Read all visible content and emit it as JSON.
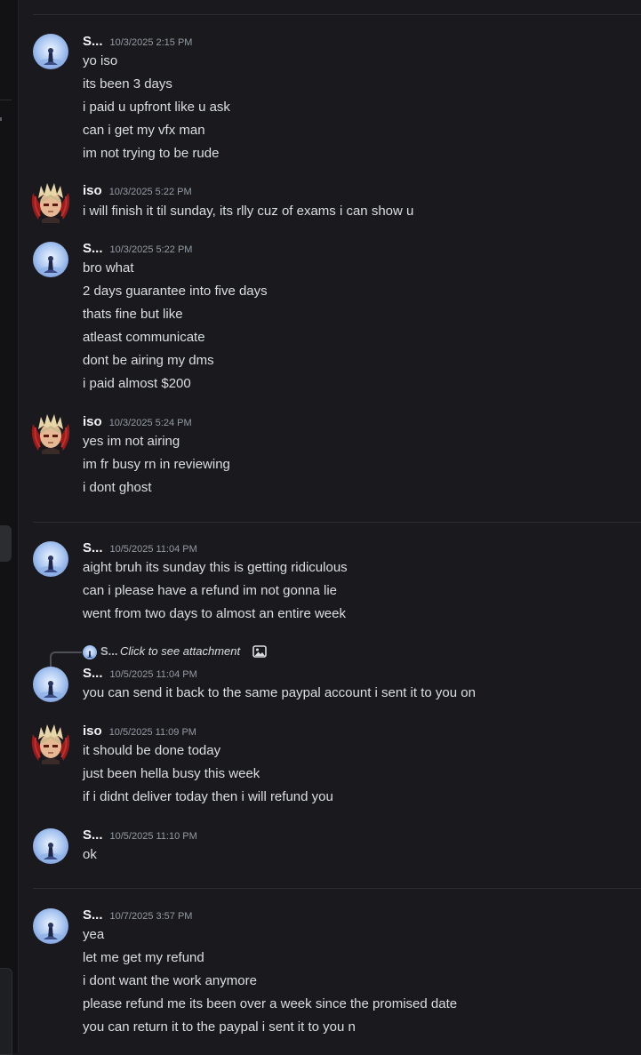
{
  "messages": [
    {
      "author": "S...",
      "timestamp": "10/3/2025 2:15 PM",
      "lines": [
        "yo iso",
        "its been 3 days",
        "i paid u upfront like u ask",
        "can i get my vfx man",
        "im not trying to be rude"
      ]
    },
    {
      "author": "iso",
      "timestamp": "10/3/2025 5:22 PM",
      "lines": [
        "i will finish it til sunday, its rlly cuz of exams i can show u"
      ]
    },
    {
      "author": "S...",
      "timestamp": "10/3/2025 5:22 PM",
      "lines": [
        "bro what",
        "2 days guarantee into five days",
        "thats fine but like",
        "atleast communicate",
        "dont be airing my dms",
        "i paid almost $200"
      ]
    },
    {
      "author": "iso",
      "timestamp": "10/3/2025 5:24 PM",
      "lines": [
        "yes im not airing",
        "im fr busy rn in reviewing",
        "i dont ghost"
      ]
    },
    {
      "author": "S...",
      "timestamp": "10/5/2025 11:04 PM",
      "lines": [
        "aight bruh its sunday this is getting ridiculous",
        "can i please have a refund im not gonna lie",
        "went from two days to almost an entire week"
      ]
    },
    {
      "author": "S...",
      "timestamp": "10/5/2025 11:04 PM",
      "lines": [
        "you can send it back to the same paypal account i sent it to you on"
      ]
    },
    {
      "author": "iso",
      "timestamp": "10/5/2025 11:09 PM",
      "lines": [
        "it should be done today",
        "just been hella busy this week",
        "if i didnt deliver today then i will refund you"
      ]
    },
    {
      "author": "S...",
      "timestamp": "10/5/2025 11:10 PM",
      "lines": [
        "ok"
      ]
    },
    {
      "author": "S...",
      "timestamp": "10/7/2025 3:57 PM",
      "lines": [
        "yea",
        "let me get my refund",
        "i dont want the work anymore",
        "please refund me its been over a week since the promised date",
        "you can return it to the paypal i sent it to you n"
      ]
    }
  ],
  "reply": {
    "author": "S...",
    "text": "Click to see attachment",
    "icon": "image-icon"
  },
  "colors": {
    "background": "#1a1a1e",
    "text": "#dbdee1",
    "timestamp": "#949ba4",
    "username": "#f2f3f5"
  }
}
